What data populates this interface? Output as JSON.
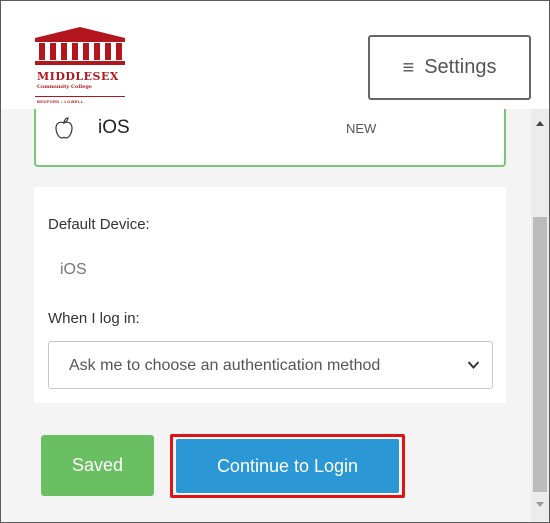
{
  "logo": {
    "name": "MIDDLESEX",
    "subtitle": "Community College",
    "location": "BEDFORD • LOWELL",
    "color": "#b3171d"
  },
  "header": {
    "settings_label": "Settings",
    "settings_icon": "hamburger-menu-icon"
  },
  "device": {
    "icon": "apple-icon",
    "name": "iOS",
    "badge": "NEW"
  },
  "settings": {
    "default_device_label": "Default Device:",
    "default_device_value": "iOS",
    "login_label": "When I log in:",
    "login_option_selected": "Ask me to choose an authentication method"
  },
  "actions": {
    "saved_label": "Saved",
    "continue_label": "Continue to Login"
  },
  "colors": {
    "saved_button": "#6abf63",
    "continue_button": "#2b97d4",
    "highlight_outline": "#e01414",
    "device_card_border": "#7cc576"
  }
}
